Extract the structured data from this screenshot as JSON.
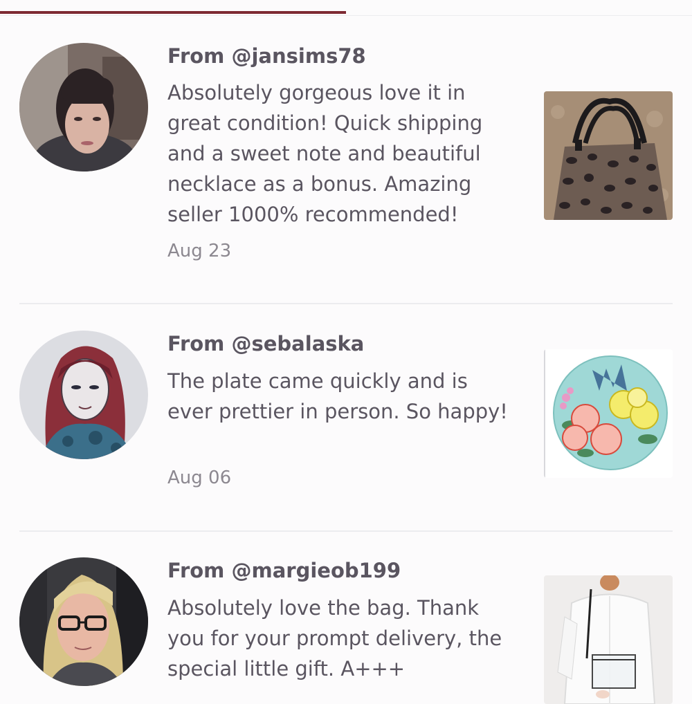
{
  "reviews": [
    {
      "author": "From @jansims78",
      "text": "Absolutely gorgeous love it in great condition! Quick shipping and a sweet note and beautiful necklace as a bonus. Amazing seller 1000% recommended!",
      "date": "Aug 23",
      "avatar_icon": "user-avatar-photo",
      "item_icon": "leopard-print-handbag-photo"
    },
    {
      "author": "From @sebalaska",
      "text": "The plate came quickly and is ever prettier in person. So happy!",
      "date": "Aug 06",
      "avatar_icon": "user-avatar-painted-portrait",
      "item_icon": "floral-plate-photo"
    },
    {
      "author": "From @margieob199",
      "text": "Absolutely love the bag. Thank you for your prompt delivery, the special little gift. A+++",
      "date": "",
      "avatar_icon": "user-avatar-photo",
      "item_icon": "clear-crossbody-bag-photo"
    }
  ],
  "colors": {
    "accent": "#7e2a33",
    "background": "#fcfbfc",
    "text": "#5a5560",
    "muted": "#8c8890",
    "divider": "#ececef"
  }
}
